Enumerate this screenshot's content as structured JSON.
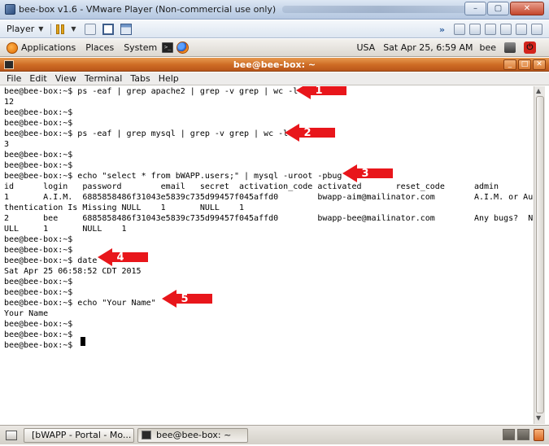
{
  "vmware": {
    "window_title": "bee-box v1.6 - VMware Player (Non-commercial use only)",
    "player_menu_label": "Player",
    "buttons": {
      "minimize": "–",
      "maximize": "▢",
      "close": "✕"
    },
    "toolbar_overflow": "»"
  },
  "gnome_panel": {
    "menus": [
      "Applications",
      "Places",
      "System"
    ],
    "keyboard_layout": "USA",
    "clock": "Sat Apr 25,  6:59 AM",
    "user": "bee"
  },
  "terminal": {
    "window_title": "bee@bee-box: ~",
    "title_buttons": [
      "_",
      "□",
      "✕"
    ],
    "menu": [
      "File",
      "Edit",
      "View",
      "Terminal",
      "Tabs",
      "Help"
    ],
    "lines": [
      "bee@bee-box:~$ ps -eaf | grep apache2 | grep -v grep | wc -l",
      "12",
      "bee@bee-box:~$",
      "bee@bee-box:~$",
      "bee@bee-box:~$ ps -eaf | grep mysql | grep -v grep | wc -l",
      "3",
      "bee@bee-box:~$",
      "bee@bee-box:~$",
      "bee@bee-box:~$ echo \"select * from bWAPP.users;\" | mysql -uroot -pbug",
      "id      login   password        email   secret  activation_code activated       reset_code      admin",
      "1       A.I.M.  6885858486f31043e5839c735d99457f045affd0        bwapp-aim@mailinator.com        A.I.M. or Au",
      "thentication Is Missing NULL    1       NULL    1",
      "2       bee     6885858486f31043e5839c735d99457f045affd0        bwapp-bee@mailinator.com        Any bugs?  N",
      "ULL     1       NULL    1",
      "bee@bee-box:~$",
      "bee@bee-box:~$",
      "bee@bee-box:~$ date",
      "Sat Apr 25 06:58:52 CDT 2015",
      "bee@bee-box:~$",
      "bee@bee-box:~$",
      "bee@bee-box:~$ echo \"Your Name\"",
      "Your Name",
      "bee@bee-box:~$",
      "bee@bee-box:~$",
      "bee@bee-box:~$"
    ]
  },
  "annotations": [
    "1",
    "2",
    "3",
    "4",
    "5"
  ],
  "taskbar": {
    "items": [
      "[bWAPP - Portal - Mo...",
      "bee@bee-box: ~"
    ]
  },
  "colors": {
    "terminal_title_orange": "#cd6b24",
    "annotation_red": "#e8161b"
  }
}
